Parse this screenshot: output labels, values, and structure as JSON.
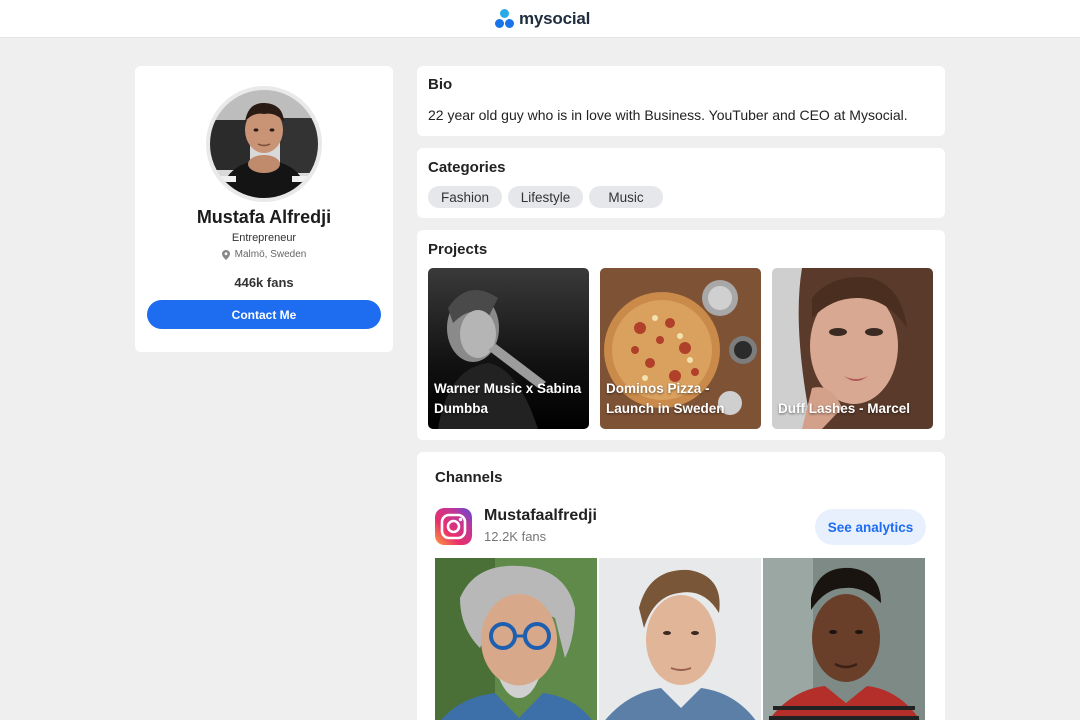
{
  "app": {
    "brand_name": "mysocial",
    "logo_icon": "three-dots-logo",
    "accent_color": "#1e6cf0"
  },
  "profile": {
    "name": "Mustafa Alfredji",
    "role": "Entrepreneur",
    "location": "Malmö, Sweden",
    "fans": "446k fans",
    "contact_label": "Contact Me"
  },
  "bio": {
    "title": "Bio",
    "text": "22 year old guy who is in love with Business. YouTuber and CEO at Mysocial."
  },
  "categories": {
    "title": "Categories",
    "items": [
      "Fashion",
      "Lifestyle",
      "Music"
    ]
  },
  "projects": {
    "title": "Projects",
    "items": [
      {
        "label": "Warner Music x Sabina Dumbba"
      },
      {
        "label": "Dominos Pizza - Launch in Sweden"
      },
      {
        "label": "Duff Lashes - Marcel"
      }
    ]
  },
  "channels": {
    "title": "Channels",
    "items": [
      {
        "icon": "instagram-icon",
        "name": "Mustafaalfredji",
        "fans": "12.2K fans",
        "action_label": "See analytics"
      }
    ]
  }
}
